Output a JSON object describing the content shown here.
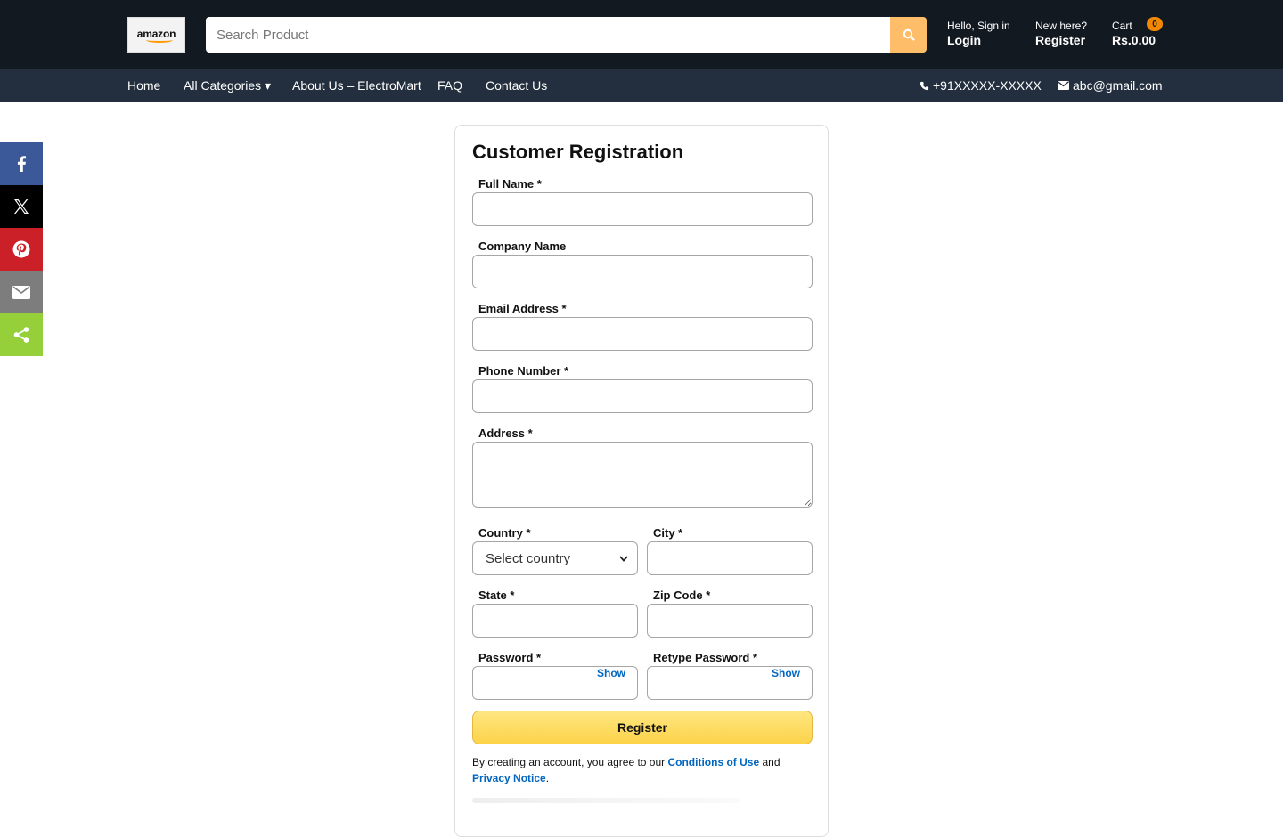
{
  "header": {
    "logo_text": "amazon",
    "search_placeholder": "Search Product",
    "account_greeting": "Hello, Sign in",
    "account_action": "Login",
    "register_greeting": "New here?",
    "register_action": "Register",
    "cart_label": "Cart",
    "cart_total": "Rs.0.00",
    "cart_count": "0"
  },
  "nav": {
    "items": [
      "Home",
      "All Categories ▾",
      "About Us – ElectroMart",
      "FAQ",
      "Contact Us"
    ],
    "phone": "+91XXXXX-XXXXX",
    "email": "abc@gmail.com"
  },
  "social": [
    {
      "name": "facebook",
      "color": "#3b5998"
    },
    {
      "name": "x",
      "color": "#000000"
    },
    {
      "name": "pinterest",
      "color": "#cb2027"
    },
    {
      "name": "email",
      "color": "#7d7d7d"
    },
    {
      "name": "share",
      "color": "#95d03a"
    }
  ],
  "form": {
    "title": "Customer Registration",
    "full_name_label": "Full Name *",
    "company_label": "Company Name",
    "email_label": "Email Address *",
    "phone_label": "Phone Number *",
    "address_label": "Address *",
    "country_label": "Country *",
    "country_value": "Select country",
    "city_label": "City *",
    "state_label": "State *",
    "zip_label": "Zip Code *",
    "password_label": "Password *",
    "retype_label": "Retype Password *",
    "show_label": "Show",
    "register_button": "Register",
    "terms_prefix": "By creating an account, you agree to our ",
    "terms_conditions": "Conditions of Use",
    "terms_and": " and ",
    "terms_privacy": "Privacy Notice",
    "terms_suffix": "."
  },
  "colors": {
    "topbar": "#131921",
    "navbar": "#232f3e",
    "search_button": "#febd69",
    "link": "#0066c0",
    "register_button": "#fcd34a"
  }
}
